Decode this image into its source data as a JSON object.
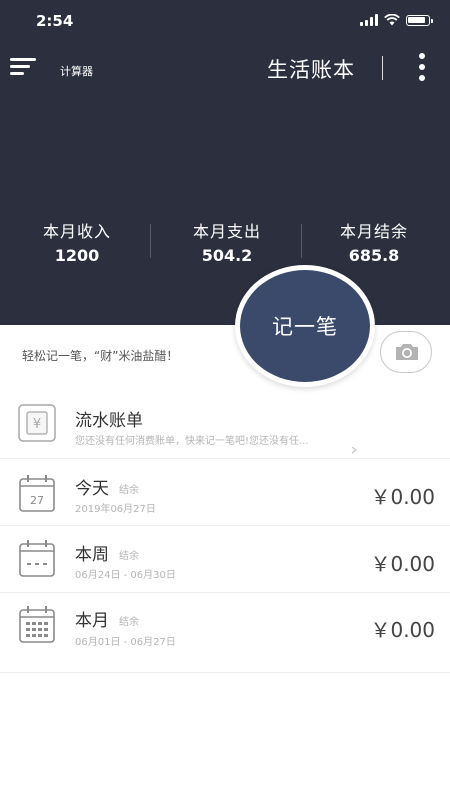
{
  "status_bar": {
    "time": "2:54"
  },
  "header": {
    "menu_label": "计算器",
    "title": "生活账本",
    "stats": [
      {
        "label": "本月收入",
        "value": "1200"
      },
      {
        "label": "本月支出",
        "value": "504.2"
      },
      {
        "label": "本月结余",
        "value": "685.8"
      }
    ]
  },
  "record_button": {
    "label": "记一笔"
  },
  "slogan": "轻松记一笔，“财”米油盐醋！",
  "bill": {
    "title": "流水账单",
    "description": "您还没有任何消费账单，快来记一笔吧!您还没有任..."
  },
  "periods": [
    {
      "title": "今天",
      "tag": "结余",
      "range": "2019年06月27日",
      "amount": "￥0.00",
      "icon": "calendar-day-icon",
      "day": "27"
    },
    {
      "title": "本周",
      "tag": "结余",
      "range": "06月24日 - 06月30日",
      "amount": "￥0.00",
      "icon": "calendar-week-icon"
    },
    {
      "title": "本月",
      "tag": "结余",
      "range": "06月01日 - 06月27日",
      "amount": "￥0.00",
      "icon": "calendar-month-icon"
    }
  ],
  "colors": {
    "header_bg": "#2c2f3e",
    "accent": "#3b4a6b"
  }
}
